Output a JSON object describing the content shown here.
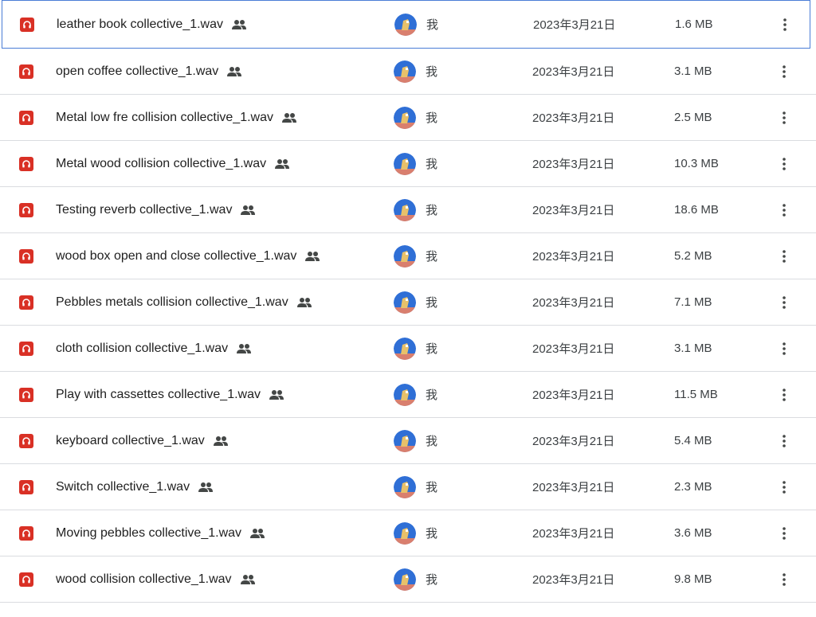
{
  "files": [
    {
      "name": "leather book collective_1.wav",
      "owner": "我",
      "modified": "2023年3月21日",
      "size": "1.6 MB",
      "icon": "audio-file-icon",
      "shared": "shared-people-icon",
      "selected": true
    },
    {
      "name": "open coffee collective_1.wav",
      "owner": "我",
      "modified": "2023年3月21日",
      "size": "3.1 MB",
      "icon": "audio-file-icon",
      "shared": "shared-people-icon"
    },
    {
      "name": "Metal low fre collision collective_1.wav",
      "owner": "我",
      "modified": "2023年3月21日",
      "size": "2.5 MB",
      "icon": "audio-file-icon",
      "shared": "shared-people-icon"
    },
    {
      "name": "Metal wood collision collective_1.wav",
      "owner": "我",
      "modified": "2023年3月21日",
      "size": "10.3 MB",
      "icon": "audio-file-icon",
      "shared": "shared-people-icon"
    },
    {
      "name": "Testing reverb collective_1.wav",
      "owner": "我",
      "modified": "2023年3月21日",
      "size": "18.6 MB",
      "icon": "audio-file-icon",
      "shared": "shared-people-icon"
    },
    {
      "name": "wood box open and close collective_1.wav",
      "owner": "我",
      "modified": "2023年3月21日",
      "size": "5.2 MB",
      "icon": "audio-file-icon",
      "shared": "shared-people-icon"
    },
    {
      "name": "Pebbles metals collision collective_1.wav",
      "owner": "我",
      "modified": "2023年3月21日",
      "size": "7.1 MB",
      "icon": "audio-file-icon",
      "shared": "shared-people-icon"
    },
    {
      "name": "cloth collision collective_1.wav",
      "owner": "我",
      "modified": "2023年3月21日",
      "size": "3.1 MB",
      "icon": "audio-file-icon",
      "shared": "shared-people-icon"
    },
    {
      "name": "Play with cassettes collective_1.wav",
      "owner": "我",
      "modified": "2023年3月21日",
      "size": "11.5 MB",
      "icon": "audio-file-icon",
      "shared": "shared-people-icon"
    },
    {
      "name": "keyboard collective_1.wav",
      "owner": "我",
      "modified": "2023年3月21日",
      "size": "5.4 MB",
      "icon": "audio-file-icon",
      "shared": "shared-people-icon"
    },
    {
      "name": "Switch collective_1.wav",
      "owner": "我",
      "modified": "2023年3月21日",
      "size": "2.3 MB",
      "icon": "audio-file-icon",
      "shared": "shared-people-icon"
    },
    {
      "name": "Moving pebbles collective_1.wav",
      "owner": "我",
      "modified": "2023年3月21日",
      "size": "3.6 MB",
      "icon": "audio-file-icon",
      "shared": "shared-people-icon"
    },
    {
      "name": "wood collision collective_1.wav",
      "owner": "我",
      "modified": "2023年3月21日",
      "size": "9.8 MB",
      "icon": "audio-file-icon",
      "shared": "shared-people-icon"
    }
  ],
  "colors": {
    "audio_icon": "#d93025",
    "selection_border": "#4a7dd6",
    "divider": "#dadce0",
    "text_primary": "#1f1f1f",
    "text_secondary": "#3c4043",
    "avatar_bg": "#2f6fd6",
    "avatar_accent": "#e8c16a"
  }
}
